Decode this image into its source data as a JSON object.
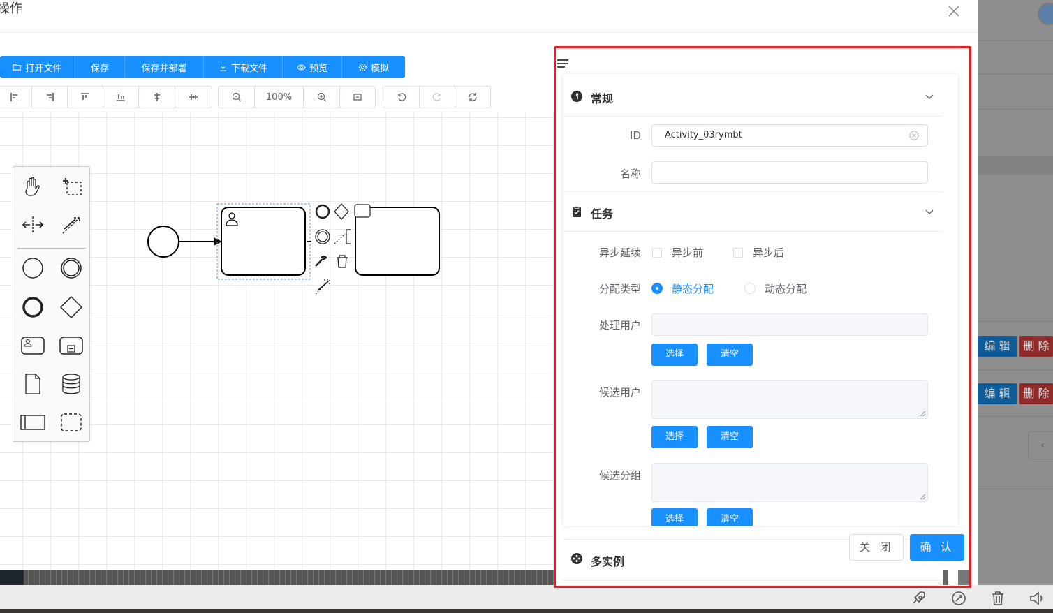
{
  "dialog": {
    "title": "操作",
    "close_icon": "close-icon"
  },
  "toolbar": {
    "buttons": [
      {
        "label": "打开文件",
        "icon": "folder-open-icon"
      },
      {
        "label": "保存",
        "icon": ""
      },
      {
        "label": "保存并部署",
        "icon": ""
      },
      {
        "label": "下载文件",
        "icon": "download-icon"
      },
      {
        "label": "预览",
        "icon": "eye-icon"
      },
      {
        "label": "模拟",
        "icon": "gear-icon"
      }
    ],
    "zoom_label": "100%"
  },
  "panel": {
    "general": {
      "title": "常规",
      "id_label": "ID",
      "id_value": "Activity_03rymbt",
      "name_label": "名称",
      "name_value": ""
    },
    "task": {
      "title": "任务",
      "async_label": "异步延续",
      "async_before": "异步前",
      "async_after": "异步后",
      "assign_type_label": "分配类型",
      "assign_static": "静态分配",
      "assign_dynamic": "动态分配",
      "assignee_label": "处理用户",
      "candidate_users_label": "候选用户",
      "candidate_groups_label": "候选分组",
      "select_label": "选择",
      "clear_label": "清空"
    },
    "multi_instance": {
      "title": "多实例"
    }
  },
  "footer": {
    "close_label": "关 闭",
    "confirm_label": "确 认"
  },
  "background": {
    "edit_label": "编 辑",
    "delete_label": "删 除"
  },
  "colors": {
    "primary": "#1890ff",
    "highlight_border": "#e02020"
  }
}
